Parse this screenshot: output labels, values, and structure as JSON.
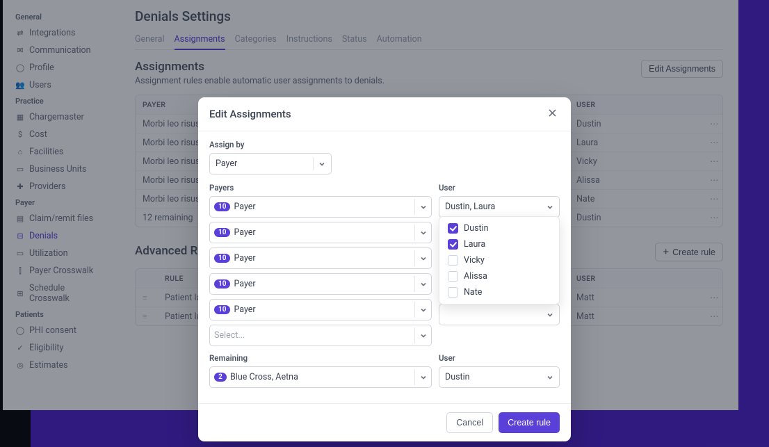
{
  "page": {
    "title": "Denials Settings"
  },
  "sidebar": {
    "sections": [
      {
        "title": "General",
        "items": [
          {
            "icon": "arrows",
            "label": "Integrations"
          },
          {
            "icon": "chat",
            "label": "Communication"
          },
          {
            "icon": "user",
            "label": "Profile"
          },
          {
            "icon": "users",
            "label": "Users"
          }
        ]
      },
      {
        "title": "Practice",
        "items": [
          {
            "icon": "grid",
            "label": "Chargemaster"
          },
          {
            "icon": "dollar",
            "label": "Cost"
          },
          {
            "icon": "building",
            "label": "Facilities"
          },
          {
            "icon": "briefcase",
            "label": "Business Units"
          },
          {
            "icon": "steth",
            "label": "Providers"
          }
        ]
      },
      {
        "title": "Payer",
        "items": [
          {
            "icon": "files",
            "label": "Claim/remit files"
          },
          {
            "icon": "x-square",
            "label": "Denials",
            "active": true
          },
          {
            "icon": "folder",
            "label": "Utilization"
          },
          {
            "icon": "map",
            "label": "Payer Crosswalk"
          },
          {
            "icon": "calendar",
            "label": "Schedule Crosswalk"
          }
        ]
      },
      {
        "title": "Patients",
        "items": [
          {
            "icon": "shield",
            "label": "PHI consent"
          },
          {
            "icon": "check-badge",
            "label": "Eligibility"
          },
          {
            "icon": "target",
            "label": "Estimates"
          }
        ]
      }
    ]
  },
  "tabs": [
    {
      "label": "General"
    },
    {
      "label": "Assignments",
      "active": true
    },
    {
      "label": "Categories"
    },
    {
      "label": "Instructions"
    },
    {
      "label": "Status"
    },
    {
      "label": "Automation"
    }
  ],
  "assignments": {
    "title": "Assignments",
    "desc": "Assignment rules enable automatic user assignments to denials.",
    "edit_button": "Edit Assignments",
    "headers": {
      "payer": "Payer",
      "user": "User"
    },
    "rows": [
      {
        "payer": "Morbi leo risus, porta ac consectetur ac, vestibulum at eros.",
        "user": "Dustin"
      },
      {
        "payer": "Morbi leo risus, porta ac consectetur ac, vestibulum at eros.",
        "user": "Laura"
      },
      {
        "payer": "Morbi leo risus, porta ac consectetur ac, vestibulum at eros.",
        "user": "Vicky"
      },
      {
        "payer": "Morbi leo risus, porta ac consectetur ac, vestibulum at eros.",
        "user": "Alissa"
      },
      {
        "payer": "Morbi leo risus, porta ac consectetur ac, vestibulum at eros.",
        "user": "Nate"
      }
    ],
    "remaining_text": "12 remaining",
    "remaining_user": "Dustin"
  },
  "advanced": {
    "title": "Advanced Rules",
    "create_button": "Create rule",
    "headers": {
      "rule": "Rule",
      "user": "User"
    },
    "rows": [
      {
        "rule": "Patient last name A-L",
        "user": "Matt"
      },
      {
        "rule": "Patient last name M-Z",
        "user": "Matt"
      }
    ]
  },
  "modal": {
    "title": "Edit Assignments",
    "assign_by_label": "Assign by",
    "assign_by_value": "Payer",
    "payers_label": "Payers",
    "user_label": "User",
    "payer_rows": [
      {
        "count": "10",
        "text": "Payer"
      },
      {
        "count": "10",
        "text": "Payer"
      },
      {
        "count": "10",
        "text": "Payer"
      },
      {
        "count": "10",
        "text": "Payer"
      },
      {
        "count": "10",
        "text": "Payer"
      }
    ],
    "select_placeholder": "Select...",
    "user_combo_value": "Dustin, Laura",
    "user_options": [
      {
        "name": "Dustin",
        "checked": true
      },
      {
        "name": "Laura",
        "checked": true
      },
      {
        "name": "Vicky",
        "checked": false
      },
      {
        "name": "Alissa",
        "checked": false
      },
      {
        "name": "Nate",
        "checked": false
      }
    ],
    "remaining_label": "Remaining",
    "remaining_count": "2",
    "remaining_text": "Blue Cross, Aetna",
    "remaining_user": "Dustin",
    "cancel": "Cancel",
    "submit": "Create rule"
  }
}
